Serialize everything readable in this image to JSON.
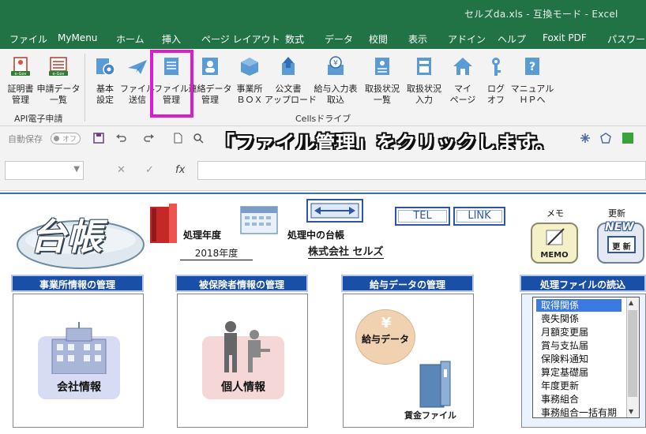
{
  "window": {
    "title": "セルズda.xls  -  互換モード  -  Excel"
  },
  "menu": {
    "tabs": [
      "ファイル",
      "MyMenu",
      "ホーム",
      "挿入",
      "ページ レイアウト",
      "数式",
      "データ",
      "校閲",
      "表示",
      "アドイン",
      "ヘルプ",
      "Foxit PDF",
      "パスワード保"
    ]
  },
  "ribbon": {
    "buttons": [
      {
        "line1": "証明書",
        "line2": "管理",
        "icon": "egov-certificate-icon"
      },
      {
        "line1": "申請データ",
        "line2": "一覧",
        "icon": "egov-application-list-icon"
      },
      {
        "line1": "基本",
        "line2": "設定",
        "icon": "gear-settings-icon"
      },
      {
        "line1": "ファイル",
        "line2": "送信",
        "icon": "paper-plane-icon"
      },
      {
        "line1": "ファイル",
        "line2": "管理",
        "icon": "file-management-icon"
      },
      {
        "line1": "連絡データ",
        "line2": "管理",
        "icon": "contact-data-icon"
      },
      {
        "line1": "事業所",
        "line2": "ＢＯＸ",
        "icon": "office-box-icon"
      },
      {
        "line1": "公文書",
        "line2": "アップロード",
        "icon": "document-upload-icon"
      },
      {
        "line1": "給与入力表",
        "line2": "取込",
        "icon": "yen-salary-icon"
      },
      {
        "line1": "取扱状況",
        "line2": "一覧",
        "icon": "status-list-icon"
      },
      {
        "line1": "取扱状況",
        "line2": "入力",
        "icon": "status-input-icon"
      },
      {
        "line1": "マイ",
        "line2": "ページ",
        "icon": "home-mypage-icon"
      },
      {
        "line1": "ログ",
        "line2": "オフ",
        "icon": "key-logoff-icon"
      },
      {
        "line1": "マニュアル",
        "line2": "ＨＰへ",
        "icon": "manual-help-icon"
      }
    ],
    "groups": [
      "API電子申請",
      "Cellsドライブ"
    ]
  },
  "qat": {
    "autosave_label": "自動保存",
    "toggle_state": "オフ"
  },
  "caption": "「ファイル管理」をクリックします。",
  "formula_bar": {
    "fx": "fx",
    "cancel": "✕",
    "enter": "✓",
    "name_box": ""
  },
  "sheet": {
    "logo": "台帳",
    "label_year": "処理年度",
    "value_year": "2018年度",
    "label_current": "処理中の台帳",
    "value_company": "株式会社  セルズ",
    "tel": "TEL",
    "link": "LINK",
    "memo_label": "メモ",
    "memo_button": "MEMO",
    "update_label": "更新",
    "update_button": "更 新",
    "new_badge": "NEW",
    "panels": {
      "office": {
        "header": "事業所情報の管理",
        "button": "会社情報"
      },
      "insured": {
        "header": "被保険者情報の管理",
        "button": "個人情報"
      },
      "salary": {
        "header": "給与データの管理",
        "button": "給与データ",
        "sub": "賃金ファイル"
      },
      "files": {
        "header": "処理ファイルの読込"
      }
    },
    "file_list": [
      "取得関係",
      "喪失関係",
      "月額変更届",
      "賞与支払届",
      "保険料通知",
      "算定基礎届",
      "年度更新",
      "事務組合",
      "事務組合一括有期"
    ]
  },
  "colors": {
    "excel_green": "#217346",
    "highlight": "#d81ecf",
    "panel_blue": "#1a4fa8"
  }
}
